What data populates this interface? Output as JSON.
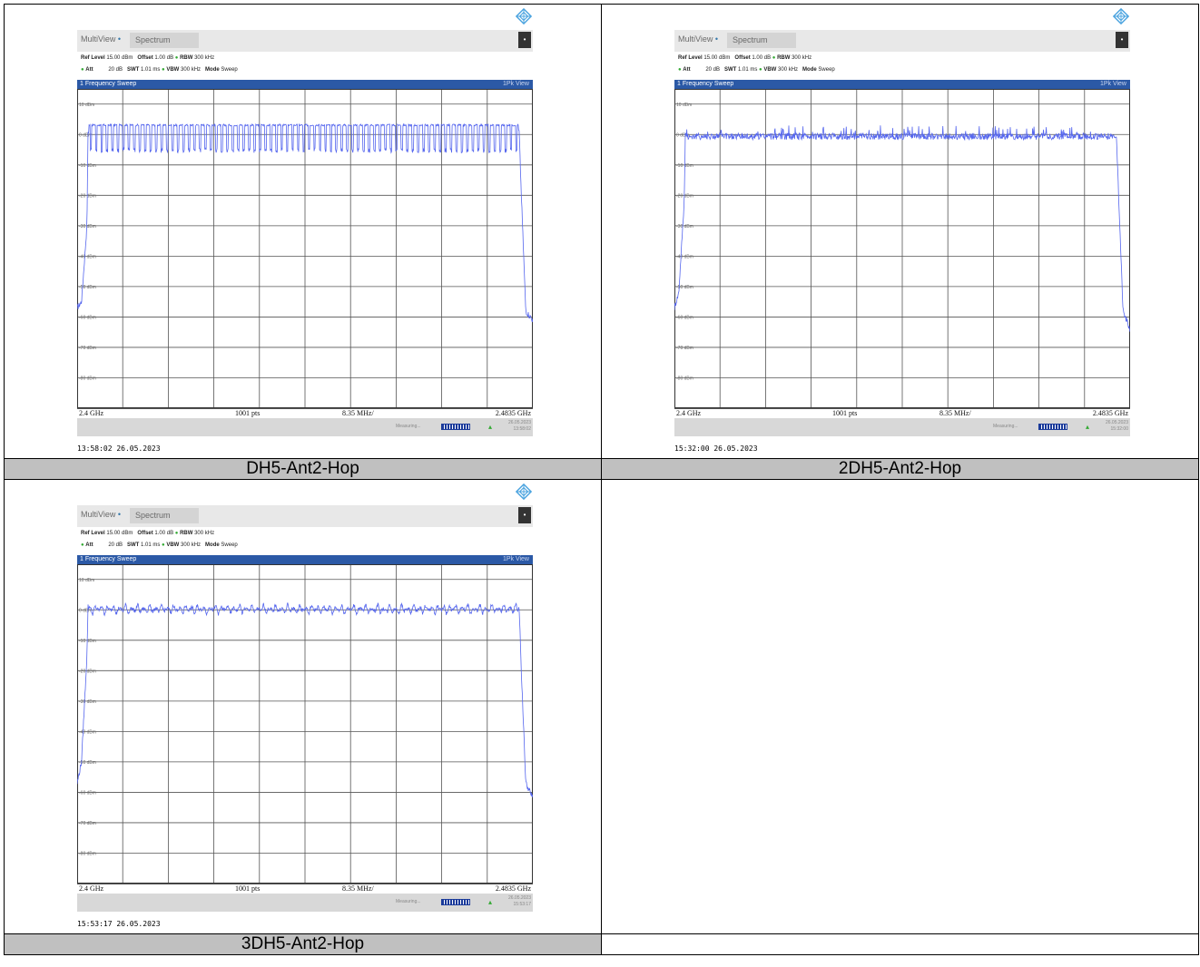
{
  "colors": {
    "trace": "#5566ee",
    "header_blue": "#2b59a6",
    "caption_bg": "#c0c0c0"
  },
  "header": {
    "multiview": "MultiView",
    "spectrum": "Spectrum",
    "ref_label": "Ref Level",
    "ref_value": "15.00 dBm",
    "offset_label": "Offset",
    "offset_value": "1.00 dB",
    "rbw_label": "RBW",
    "rbw_value": "300 kHz",
    "att_label": "Att",
    "att_value": "20 dB",
    "swt_label": "SWT",
    "swt_value": "1.01 ms",
    "vbw_label": "VBW",
    "vbw_value": "300 kHz",
    "mode_label": "Mode",
    "mode_value": "Sweep",
    "sweep_title": "1 Frequency Sweep",
    "view_label": "1Pk View"
  },
  "footer": {
    "start": "2.4 GHz",
    "points": "1001 pts",
    "span_div": "8.35 MHz/",
    "stop": "2.4835 GHz",
    "measuring": "Measuring..."
  },
  "y_tick_labels": [
    "10 dBm",
    "0 dBm",
    "-10 dBm",
    "-20 dBm",
    "-30 dBm",
    "-40 dBm",
    "-50 dBm",
    "-60 dBm",
    "-70 dBm",
    "-80 dBm"
  ],
  "panels": [
    {
      "caption": "DH5-Ant2-Hop",
      "timestamp": "13:58:02  26.05.2023",
      "status_date": "26.05.2023",
      "status_time": "13:58:02"
    },
    {
      "caption": "2DH5-Ant2-Hop",
      "timestamp": "15:32:00  26.05.2023",
      "status_date": "26.05.2023",
      "status_time": "15:32:00"
    },
    {
      "caption": "3DH5-Ant2-Hop",
      "timestamp": "15:53:17  26.05.2023",
      "status_date": "26.05.2023",
      "status_time": "15:53:17"
    }
  ],
  "chart_data": [
    {
      "type": "line",
      "title": "1 Frequency Sweep",
      "xlim": [
        2.4,
        2.4835
      ],
      "ylim": [
        -90,
        15
      ],
      "x_ticks": [
        "2.4 GHz",
        "2.4835 GHz"
      ],
      "series": [
        {
          "x": [
            2.4,
            2.4008,
            2.4018,
            2.402,
            2.42,
            2.44,
            2.46,
            2.48,
            2.481,
            2.4815,
            2.4822,
            2.4835
          ],
          "y": [
            -57,
            -55,
            -30,
            1,
            1,
            1,
            1,
            1,
            1,
            -25,
            -58,
            -61
          ]
        }
      ],
      "hop_pattern": "dense regular carrier comb, peaks near 3 dBm, notches near -5 dBm"
    },
    {
      "type": "line",
      "title": "1 Frequency Sweep",
      "xlim": [
        2.4,
        2.4835
      ],
      "ylim": [
        -90,
        15
      ],
      "x_ticks": [
        "2.4 GHz",
        "2.4835 GHz"
      ],
      "series": [
        {
          "x": [
            2.4,
            2.4008,
            2.4018,
            2.402,
            2.42,
            2.44,
            2.46,
            2.48,
            2.481,
            2.4815,
            2.4822,
            2.4835
          ],
          "y": [
            -57,
            -52,
            -22,
            0,
            0,
            0,
            0,
            0,
            0,
            -25,
            -58,
            -64
          ]
        }
      ],
      "hop_pattern": "noisy flat floor near 0 dBm with small peaks up to 3 dBm"
    },
    {
      "type": "line",
      "title": "1 Frequency Sweep",
      "xlim": [
        2.4,
        2.4835
      ],
      "ylim": [
        -90,
        15
      ],
      "x_ticks": [
        "2.4 GHz",
        "2.4835 GHz"
      ],
      "series": [
        {
          "x": [
            2.4,
            2.4008,
            2.4018,
            2.402,
            2.42,
            2.44,
            2.46,
            2.48,
            2.481,
            2.4815,
            2.4822,
            2.4835
          ],
          "y": [
            -57,
            -50,
            -15,
            1,
            1,
            1,
            1,
            1,
            1,
            -25,
            -57,
            -62
          ]
        }
      ],
      "hop_pattern": "irregular peaks between 0 and 3 dBm"
    }
  ]
}
